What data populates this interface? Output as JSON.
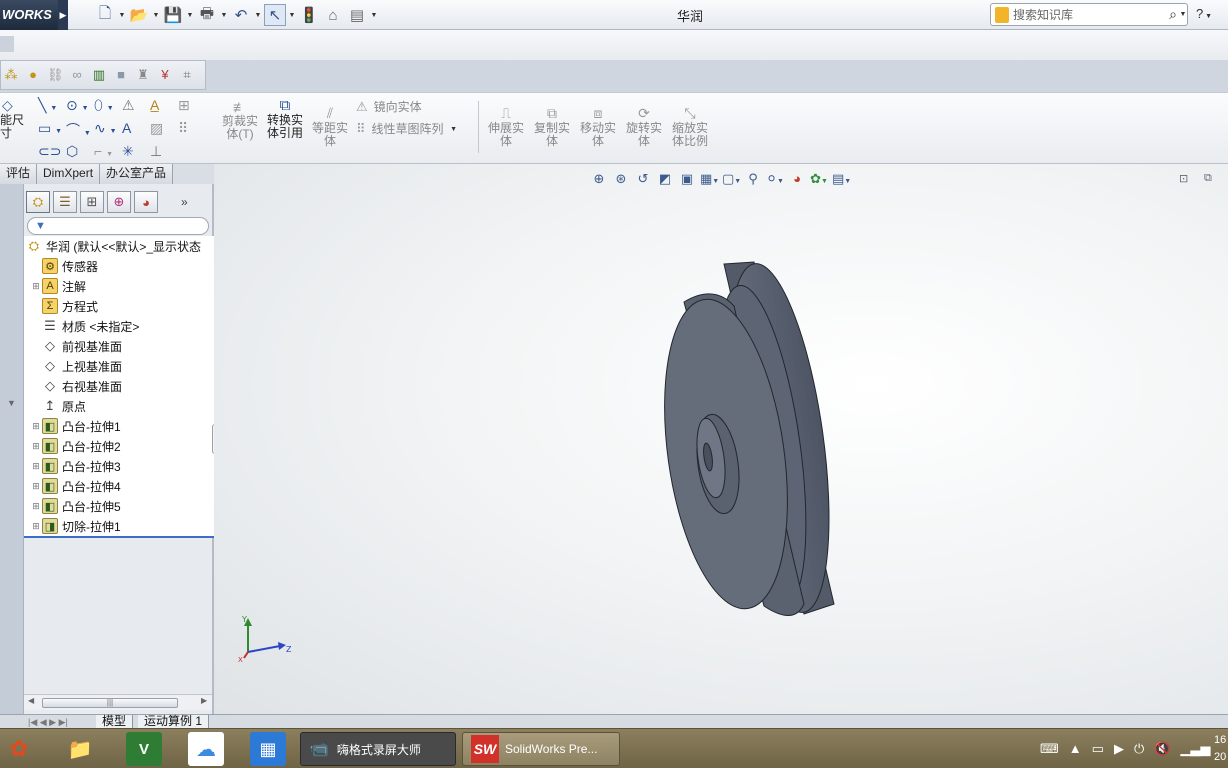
{
  "app": {
    "brand": "WORKS",
    "window_title": "华润"
  },
  "search": {
    "placeholder": "搜索知识库",
    "help": "?"
  },
  "commands": {
    "smart_dim": "能尺\n寸",
    "trim": "剪裁实\n体(T)",
    "convert": "转换实\n体引用",
    "offset": "等距实\n体",
    "mirror": "镜向实体",
    "linear_pattern": "线性草图阵列",
    "extend": "伸展实\n体",
    "copy": "复制实\n体",
    "move": "移动实\n体",
    "rotate": "旋转实\n体",
    "scale": "缩放实\n体比例"
  },
  "tabs": [
    "评估",
    "DimXpert",
    "办公室产品"
  ],
  "tree": {
    "root": "华润 (默认<<默认>_显示状态",
    "items": [
      {
        "label": "传感器",
        "icon": "sensor-icon",
        "expand": false
      },
      {
        "label": "注解",
        "icon": "annotation-icon",
        "expand": true
      },
      {
        "label": "方程式",
        "icon": "equation-icon",
        "expand": false
      },
      {
        "label": "材质 <未指定>",
        "icon": "material-icon",
        "expand": false
      },
      {
        "label": "前视基准面",
        "icon": "plane-icon",
        "expand": false
      },
      {
        "label": "上视基准面",
        "icon": "plane-icon",
        "expand": false
      },
      {
        "label": "右视基准面",
        "icon": "plane-icon",
        "expand": false
      },
      {
        "label": "原点",
        "icon": "origin-icon",
        "expand": false
      },
      {
        "label": "凸台-拉伸1",
        "icon": "extrude-icon",
        "expand": true
      },
      {
        "label": "凸台-拉伸2",
        "icon": "extrude-icon",
        "expand": true
      },
      {
        "label": "凸台-拉伸3",
        "icon": "extrude-icon",
        "expand": true
      },
      {
        "label": "凸台-拉伸4",
        "icon": "extrude-icon",
        "expand": true
      },
      {
        "label": "凸台-拉伸5",
        "icon": "extrude-icon",
        "expand": true
      },
      {
        "label": "切除-拉伸1",
        "icon": "cut-icon",
        "expand": true
      }
    ]
  },
  "bottom_tabs": [
    "模型",
    "运动算例 1"
  ],
  "triad": {
    "x": "X",
    "y": "Y",
    "z": "Z"
  },
  "taskbar": {
    "recorder": "嗨格式录屏大师",
    "solidworks": "SolidWorks Pre...",
    "clock_top": "16",
    "clock_bottom": "20"
  },
  "colors": {
    "accent": "#3d6ec6",
    "part": "#5f6776",
    "taskbar": "#7a6f50"
  }
}
